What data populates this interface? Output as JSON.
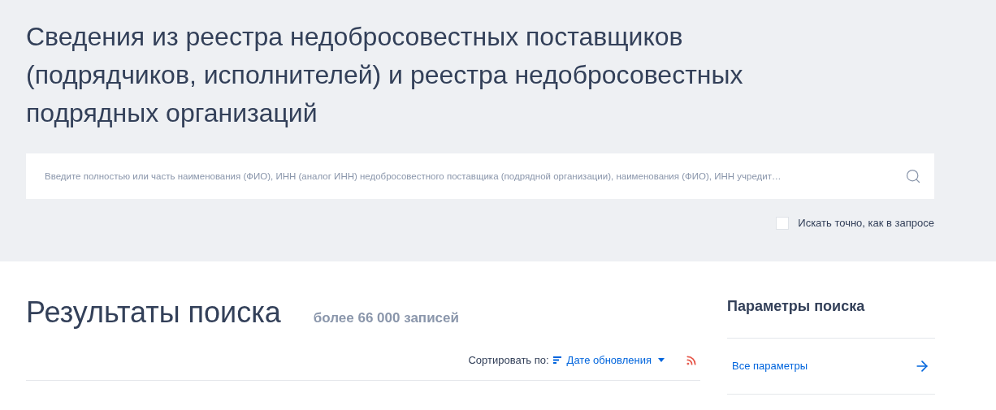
{
  "header": {
    "title": "Сведения из реестра недобросовестных поставщиков (подрядчиков, исполнителей) и реестра недобросовестных подрядных организаций"
  },
  "search": {
    "placeholder": "Введите полностью или часть наименования (ФИО), ИНН (аналог ИНН) недобросовестного поставщика (подрядной организации), наименования (ФИО), ИНН учредит…"
  },
  "exact_match": {
    "label": "Искать точно, как в запросе",
    "checked": false
  },
  "results": {
    "title": "Результаты поиска",
    "count": "более 66 000 записей",
    "sort_label": "Сортировать по:",
    "sort_value": "Дате обновления"
  },
  "sidebar": {
    "title": "Параметры поиска",
    "link": "Все параметры"
  }
}
